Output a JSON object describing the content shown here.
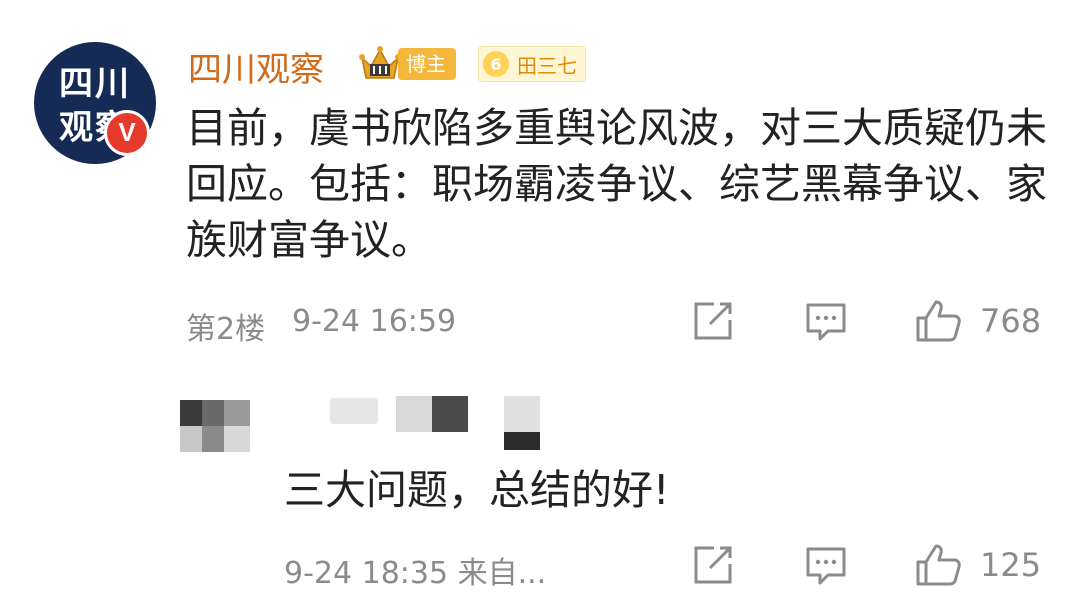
{
  "post": {
    "avatar": {
      "line1": "四川",
      "line2": "观察",
      "verified_badge": "V"
    },
    "username": "四川观察",
    "badges": {
      "crown_icon": "crown-icon",
      "blogger_label": "博主",
      "fan_level": "6",
      "fan_name": "田三七"
    },
    "content": "目前，虞书欣陷多重舆论风波，对三大质疑仍未回应。包括：职场霸凌争议、综艺黑幕争议、家族财富争议。",
    "floor": "第2楼",
    "datetime": "9-24 16:59",
    "like_count": "768"
  },
  "reply": {
    "content": "三大问题，总结的好!",
    "datetime": "9-24 18:35 来自...",
    "like_count": "125"
  },
  "colors": {
    "username": "#d16a1a",
    "meta_gray": "#8b8b8b",
    "verified_red": "#e53a2c",
    "blogger_badge": "#f5b63c",
    "avatar_bg": "#152a55"
  }
}
